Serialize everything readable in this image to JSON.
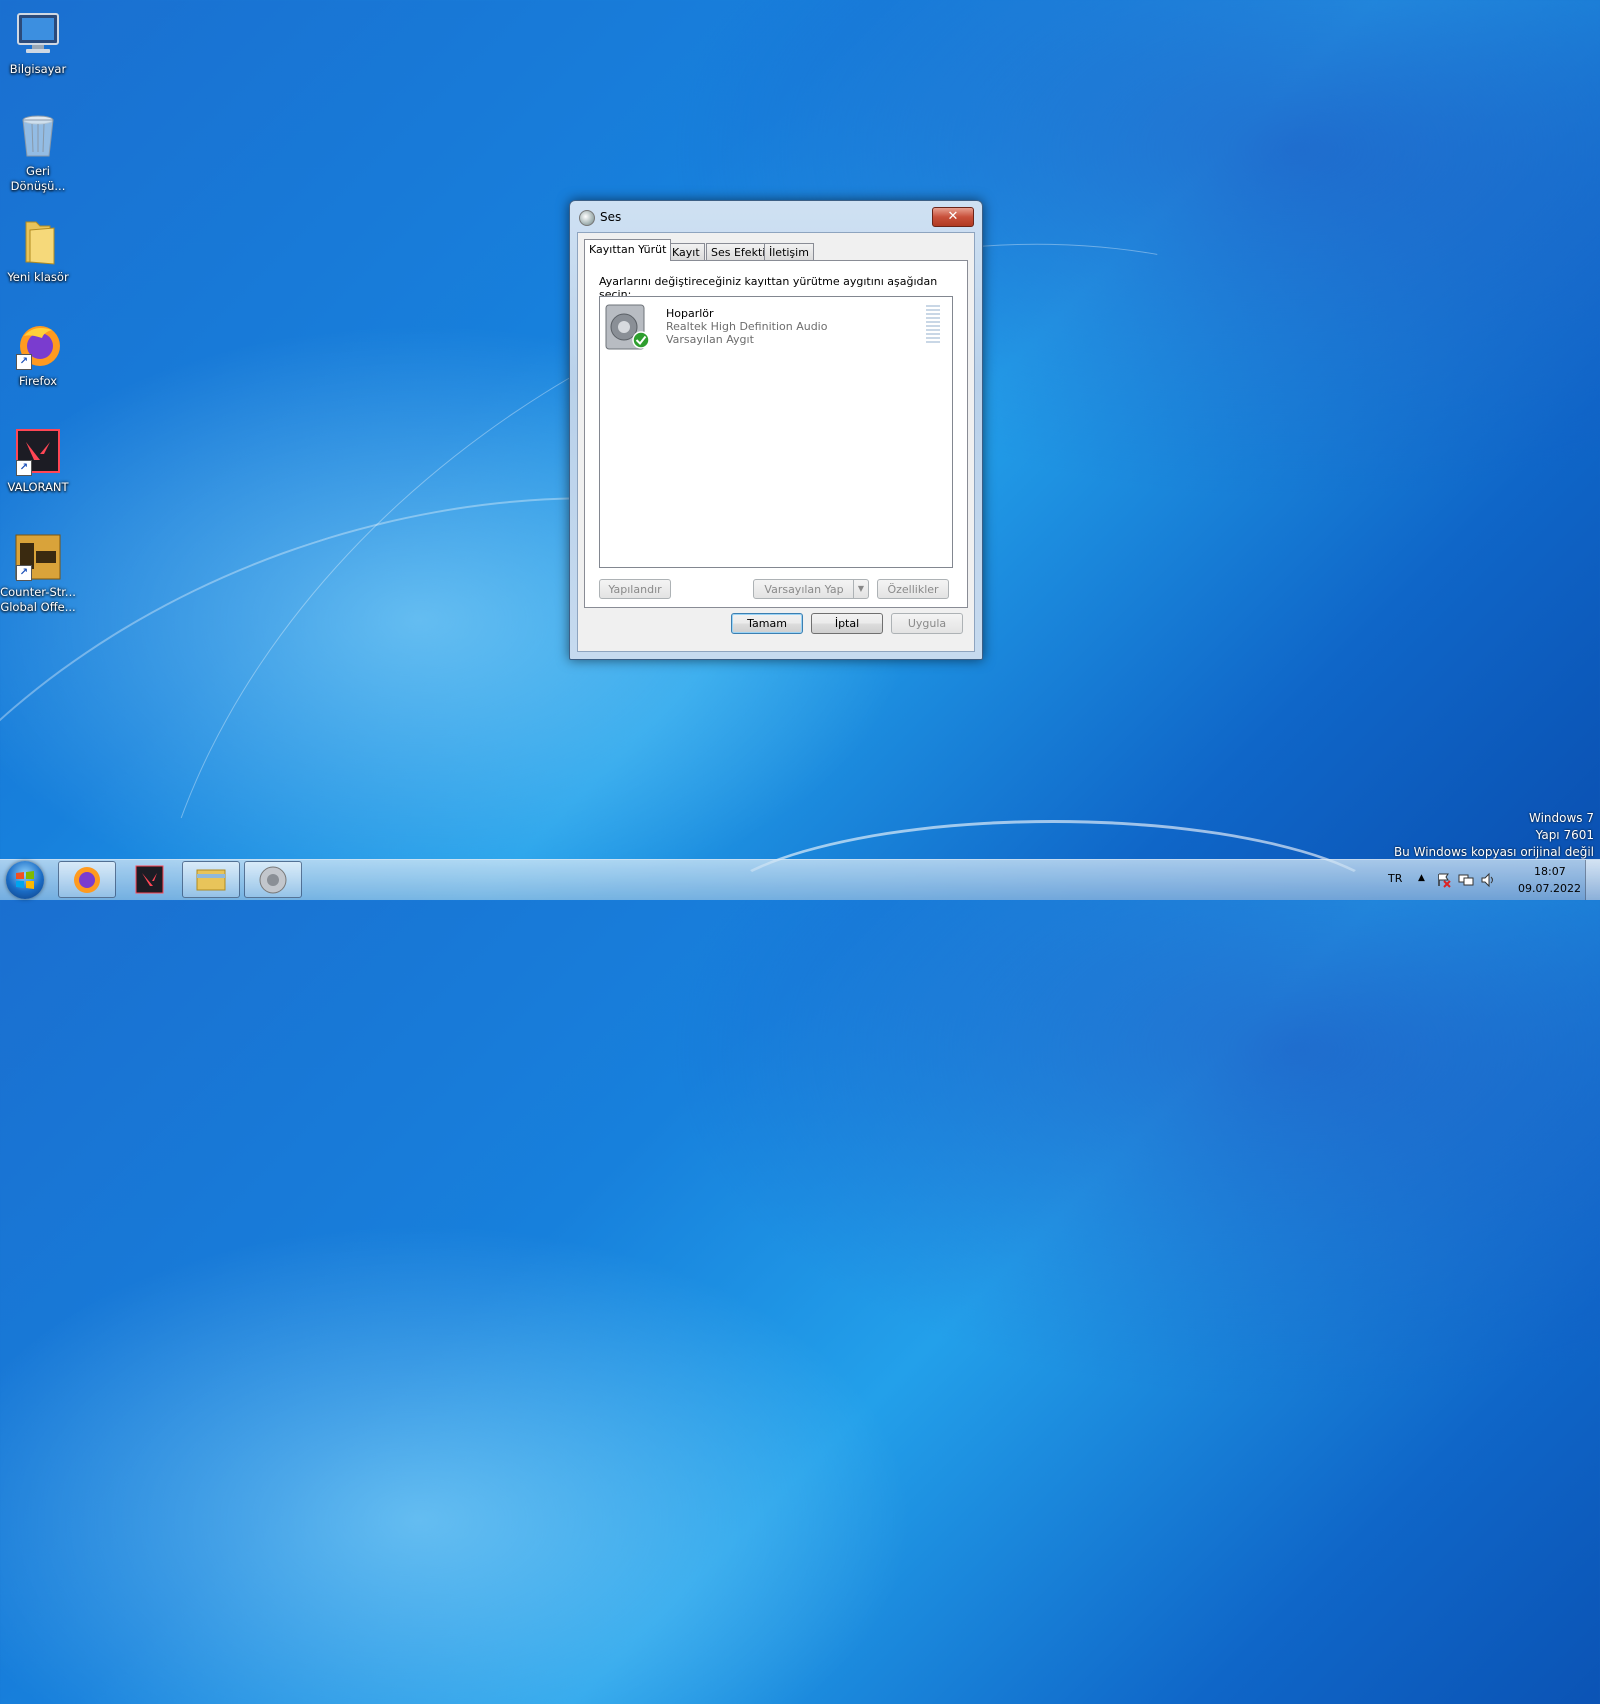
{
  "desktop": {
    "icons": [
      {
        "label": "Bilgisayar",
        "icon": "computer-icon"
      },
      {
        "label": "Geri Dönüşü...",
        "icon": "recycle-bin-icon"
      },
      {
        "label": "Yeni klasör",
        "icon": "folder-icon"
      },
      {
        "label": "Firefox",
        "icon": "firefox-icon"
      },
      {
        "label": "VALORANT",
        "icon": "valorant-icon"
      },
      {
        "label": "Counter-Str... Global Offe...",
        "icon": "csgo-icon"
      }
    ],
    "icon_line2": {
      "recycle": "Dönüşü...",
      "csgo": "Global Offe..."
    },
    "icon_line1": {
      "recycle": "Geri",
      "csgo": "Counter-Str..."
    },
    "watermark": {
      "line1": "Windows 7",
      "line2": "Yapı 7601",
      "line3": "Bu Windows kopyası orijinal değil"
    },
    "colors": {
      "accent": "#1780dc",
      "close": "#c8503a"
    }
  },
  "dialog": {
    "title": "Ses",
    "close_symbol": "✕",
    "tabs": [
      {
        "label": "Kayıttan Yürüt",
        "active": true
      },
      {
        "label": "Kayıt",
        "active": false
      },
      {
        "label": "Ses Efekti",
        "active": false
      },
      {
        "label": "İletişim",
        "active": false
      }
    ],
    "instruction": "Ayarlarını değiştireceğiniz kayıttan yürütme aygıtını aşağıdan seçin:",
    "device": {
      "name": "Hoparlör",
      "driver": "Realtek High Definition Audio",
      "status": "Varsayılan Aygıt"
    },
    "panel_buttons": {
      "configure": "Yapılandır",
      "set_default": "Varsayılan Yap",
      "properties": "Özellikler"
    },
    "footer_buttons": {
      "ok": "Tamam",
      "cancel": "İptal",
      "apply": "Uygula"
    }
  },
  "taskbar": {
    "language": "TR",
    "time": "18:07",
    "date": "09.07.2022",
    "tray_arrow": "▲"
  }
}
